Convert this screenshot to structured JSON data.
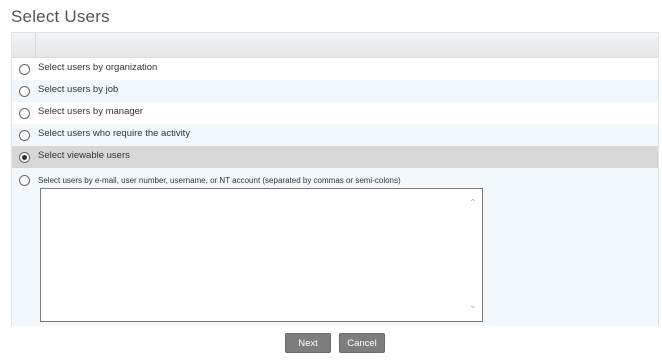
{
  "page": {
    "title": "Select Users"
  },
  "options": [
    {
      "label": "Select users by organization",
      "selected": false
    },
    {
      "label": "Select users by job",
      "selected": false
    },
    {
      "label": "Select users by manager",
      "selected": false
    },
    {
      "label": "Select users who require the activity",
      "selected": false
    },
    {
      "label": "Select viewable users",
      "selected": true
    }
  ],
  "email_option": {
    "label": "Select users by e-mail, user number, username, or NT account (separated by commas or semi-colons)",
    "selected": false,
    "value": ""
  },
  "buttons": {
    "next": "Next",
    "cancel": "Cancel"
  },
  "icons": {
    "scroll_up": "chevron-up-icon",
    "scroll_down": "chevron-down-icon"
  },
  "colors": {
    "selected_row": "#d7d7d7",
    "alt_row": "#f1f8fd",
    "button": "#7d7d7d"
  }
}
